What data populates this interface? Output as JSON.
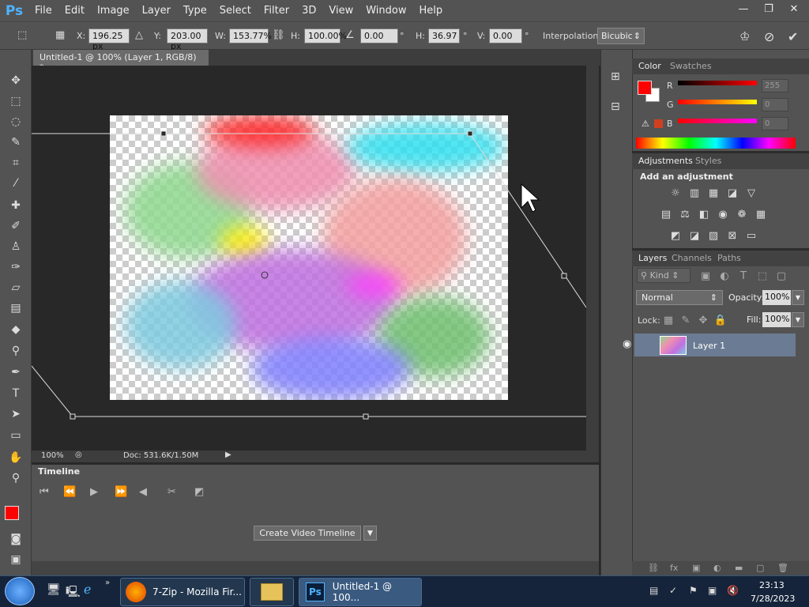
{
  "app": {
    "logo": "Ps"
  },
  "menu": [
    "File",
    "Edit",
    "Image",
    "Layer",
    "Type",
    "Select",
    "Filter",
    "3D",
    "View",
    "Window",
    "Help"
  ],
  "window_controls": [
    "—",
    "❐",
    "✕"
  ],
  "options": {
    "x_label": "X:",
    "x_value": "196.25 px",
    "y_label": "Y:",
    "y_value": "203.00 px",
    "w_label": "W:",
    "w_value": "153.77%",
    "h_label": "H:",
    "h_value": "100.00%",
    "angle_value": "0.00",
    "deg1": "°",
    "hskew_label": "H:",
    "hskew_value": "36.97",
    "deg2": "°",
    "vskew_label": "V:",
    "vskew_value": "0.00",
    "deg3": "°",
    "interp_label": "Interpolation:",
    "interp_value": "Bicubic"
  },
  "document": {
    "tab_title": "Untitled-1 @ 100% (Layer 1, RGB/8) *",
    "close": "×"
  },
  "status": {
    "zoom": "100%",
    "doc": "Doc: 531.6K/1.50M"
  },
  "timeline": {
    "title": "Timeline",
    "create_button": "Create Video Timeline"
  },
  "color_panel": {
    "tabs": [
      "Color",
      "Swatches"
    ],
    "r_label": "R",
    "r_value": "255",
    "g_label": "G",
    "g_value": "0",
    "b_label": "B",
    "b_value": "0",
    "foreground": "#ff0000",
    "background": "#ffffff"
  },
  "adjustments": {
    "tabs": [
      "Adjustments",
      "Styles"
    ],
    "heading": "Add an adjustment"
  },
  "layers": {
    "tabs": [
      "Layers",
      "Channels",
      "Paths"
    ],
    "kind_label": "Kind",
    "blend_mode": "Normal",
    "opacity_label": "Opacity:",
    "opacity_value": "100%",
    "lock_label": "Lock:",
    "fill_label": "Fill:",
    "fill_value": "100%",
    "layer_name": "Layer 1"
  },
  "taskbar": {
    "firefox_label": "7-Zip - Mozilla Fir...",
    "photoshop_label": "Untitled-1 @ 100...",
    "ps_icon": "Ps",
    "time": "23:13",
    "date": "7/28/2023"
  }
}
